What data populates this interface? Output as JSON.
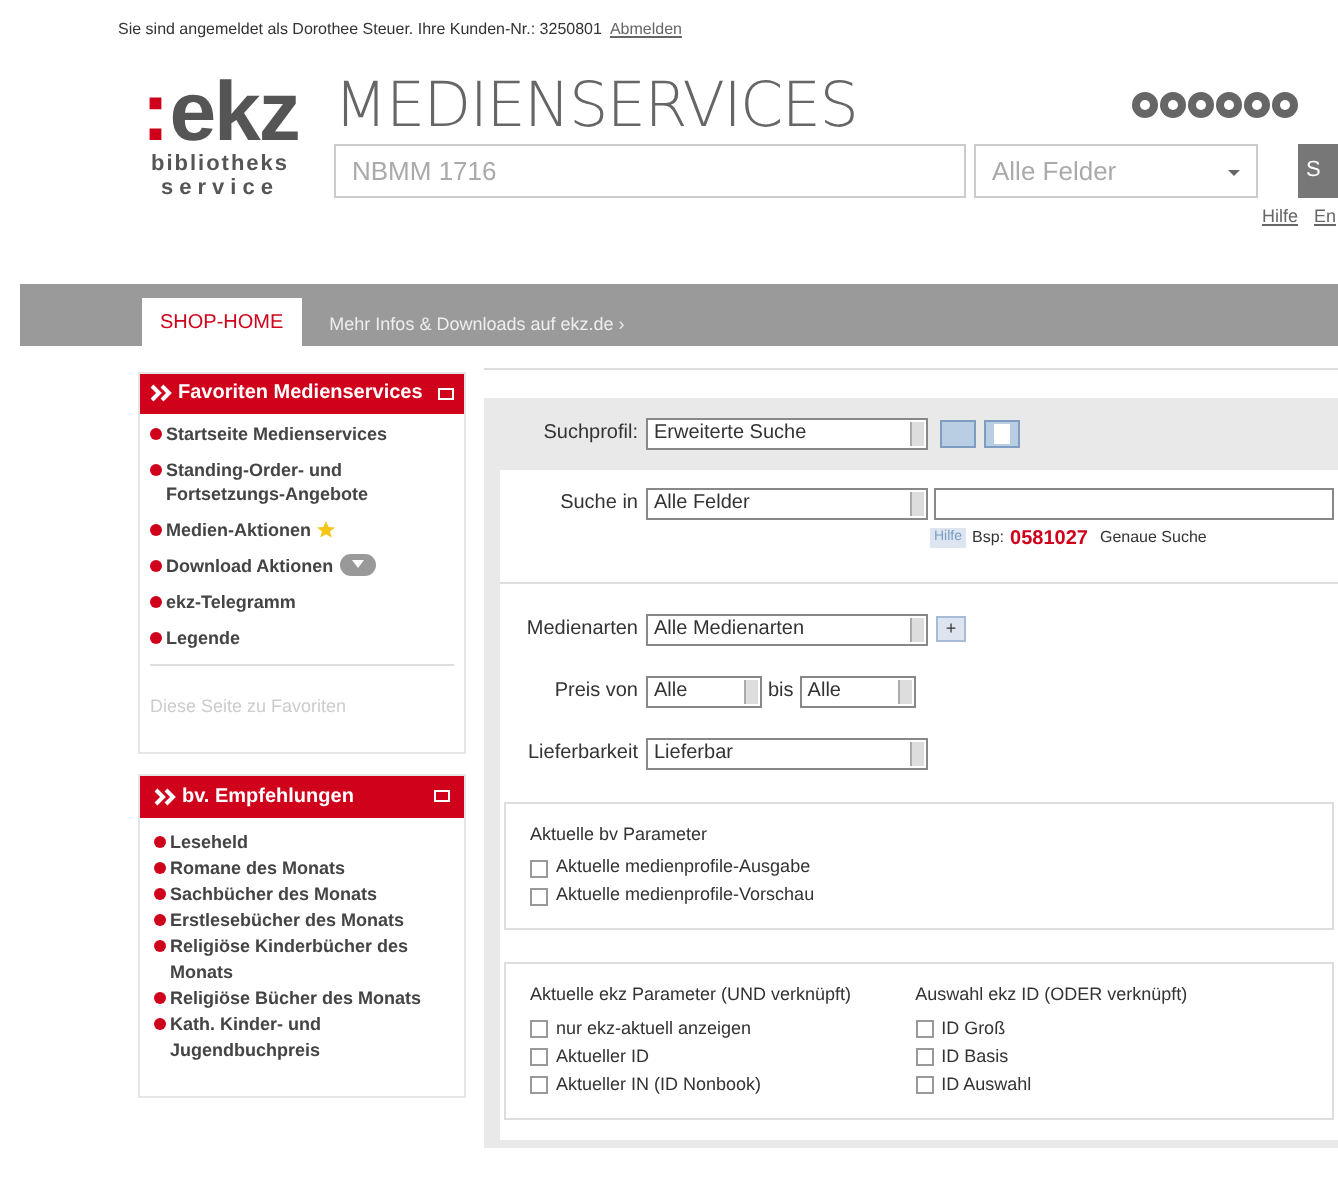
{
  "login_bar": {
    "text": "Sie sind angemeldet als Dorothee Steuer. Ihre Kunden-Nr.: 3250801",
    "link": "Abmelden"
  },
  "header": {
    "logo": {
      "mark": ":",
      "word": "ekz",
      "line_1": "bibliotheks",
      "line_2": "service"
    },
    "title": "MEDIENSERVICES",
    "search_value": "NBMM 1716",
    "field_select": "Alle Felder",
    "search_button": "S",
    "links": [
      "Hilfe",
      "En"
    ]
  },
  "nav_tabs": [
    {
      "label": "SHOP-HOME",
      "selected": true
    },
    {
      "label": "Mehr Infos & Downloads auf ekz.de ›",
      "selected": false
    }
  ],
  "favorites": {
    "title": "Favoriten Medienservices",
    "items": [
      {
        "label": "Startseite Medienservices",
        "kind": "plain"
      },
      {
        "label": "Standing-Order- und Fortsetzungs-Angebote",
        "kind": "plain"
      },
      {
        "label": "Medien-Aktionen",
        "kind": "star"
      },
      {
        "label": "Download Aktionen",
        "kind": "cloud"
      },
      {
        "label": "ekz-Telegramm",
        "kind": "plain"
      },
      {
        "label": "Legende",
        "kind": "plain"
      }
    ],
    "footer": "Diese Seite zu Favoriten"
  },
  "recommendations": {
    "title": "bv. Empfehlungen",
    "items": [
      "Leseheld",
      "Romane des Monats",
      "Sachbücher des Monats",
      "Erstlesebücher des Monats",
      "Religiöse Kinderbücher des Monats",
      "Religiöse Bücher des Monats",
      "Kath. Kinder- und Jugendbuchpreis"
    ]
  },
  "search_form": {
    "profile": {
      "label": "Suchprofil:",
      "value": "Erweiterte Suche"
    },
    "search_in": {
      "label": "Suche in",
      "value": "Alle Felder"
    },
    "hint": {
      "help": "Hilfe",
      "example_label": "Bsp:",
      "example": "0581027",
      "exact": "Genaue Suche"
    },
    "media_types": {
      "label": "Medienarten",
      "value": "Alle Medienarten",
      "add": "+"
    },
    "price": {
      "label": "Preis von",
      "from": "Alle",
      "to_label": "bis",
      "to": "Alle"
    },
    "availability": {
      "label": "Lieferbarkeit",
      "value": "Lieferbar"
    }
  },
  "bv_parameters": {
    "title": "Aktuelle bv Parameter",
    "options": [
      {
        "label": "Aktuelle medienprofile-Ausgabe",
        "checked": false
      },
      {
        "label": "Aktuelle medienprofile-Vorschau",
        "checked": false
      }
    ]
  },
  "ekz_parameters": {
    "title": "Aktuelle ekz Parameter (UND verknüpft)",
    "options": [
      {
        "label": "nur ekz-aktuell anzeigen",
        "checked": false
      },
      {
        "label": "Aktueller ID",
        "checked": false
      },
      {
        "label": "Aktueller IN (ID Nonbook)",
        "checked": false
      }
    ]
  },
  "ekz_id": {
    "title": "Auswahl ekz ID (ODER verknüpft)",
    "options": [
      {
        "label": "ID Groß",
        "checked": false
      },
      {
        "label": "ID Basis",
        "checked": false
      },
      {
        "label": "ID Auswahl",
        "checked": false
      }
    ]
  }
}
